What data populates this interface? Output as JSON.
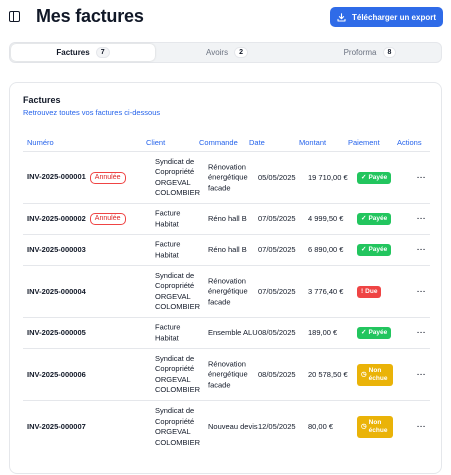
{
  "header": {
    "title": "Mes factures",
    "export_label": "Télécharger un export"
  },
  "tabs": [
    {
      "label": "Factures",
      "count": "7"
    },
    {
      "label": "Avoirs",
      "count": "2"
    },
    {
      "label": "Proforma",
      "count": "8"
    }
  ],
  "card": {
    "title": "Factures",
    "subtitle": "Retrouvez toutes vos factures ci-dessous"
  },
  "table": {
    "headers": {
      "numero": "Numéro",
      "client": "Client",
      "commande": "Commande",
      "date": "Date",
      "montant": "Montant",
      "paiement": "Paiement",
      "actions": "Actions"
    },
    "cancelled_label": "Annulée",
    "rows": [
      {
        "numero": "INV-2025-000001",
        "cancelled": true,
        "client": "Syndicat de Copropriété ORGEVAL COLOMBIER",
        "commande": "Rénovation énergétique facade",
        "date": "05/05/2025",
        "montant": "19 710,00 €",
        "paiement": "Payée",
        "status": "paid"
      },
      {
        "numero": "INV-2025-000002",
        "cancelled": true,
        "client": "Facture Habitat",
        "commande": "Réno hall B",
        "date": "07/05/2025",
        "montant": "4 999,50 €",
        "paiement": "Payée",
        "status": "paid"
      },
      {
        "numero": "INV-2025-000003",
        "cancelled": false,
        "client": "Facture Habitat",
        "commande": "Réno hall B",
        "date": "07/05/2025",
        "montant": "6 890,00 €",
        "paiement": "Payée",
        "status": "paid"
      },
      {
        "numero": "INV-2025-000004",
        "cancelled": false,
        "client": "Syndicat de Copropriété ORGEVAL COLOMBIER",
        "commande": "Rénovation énergétique facade",
        "date": "07/05/2025",
        "montant": "3 776,40 €",
        "paiement": "Due",
        "status": "due"
      },
      {
        "numero": "INV-2025-000005",
        "cancelled": false,
        "client": "Facture Habitat",
        "commande": "Ensemble ALU",
        "date": "08/05/2025",
        "montant": "189,00 €",
        "paiement": "Payée",
        "status": "paid"
      },
      {
        "numero": "INV-2025-000006",
        "cancelled": false,
        "client": "Syndicat de Copropriété ORGEVAL COLOMBIER",
        "commande": "Rénovation énergétique facade",
        "date": "08/05/2025",
        "montant": "20 578,50 €",
        "paiement": "Non échue",
        "status": "pending"
      },
      {
        "numero": "INV-2025-000007",
        "cancelled": false,
        "client": "Syndicat de Copropriété ORGEVAL COLOMBIER",
        "commande": "Nouveau devis",
        "date": "12/05/2025",
        "montant": "80,00 €",
        "paiement": "Non échue",
        "status": "pending"
      }
    ],
    "actions_label": "···"
  },
  "icons": {
    "sidebar_toggle": "sidebar-icon",
    "export": "download-icon",
    "paid": "check-icon",
    "due": "alert-circle-icon",
    "pending": "clock-icon"
  },
  "colors": {
    "primary": "#2f6be8",
    "paid": "#22c55e",
    "due": "#ef4444",
    "pending": "#eab308",
    "cancelled": "#dc2626"
  }
}
